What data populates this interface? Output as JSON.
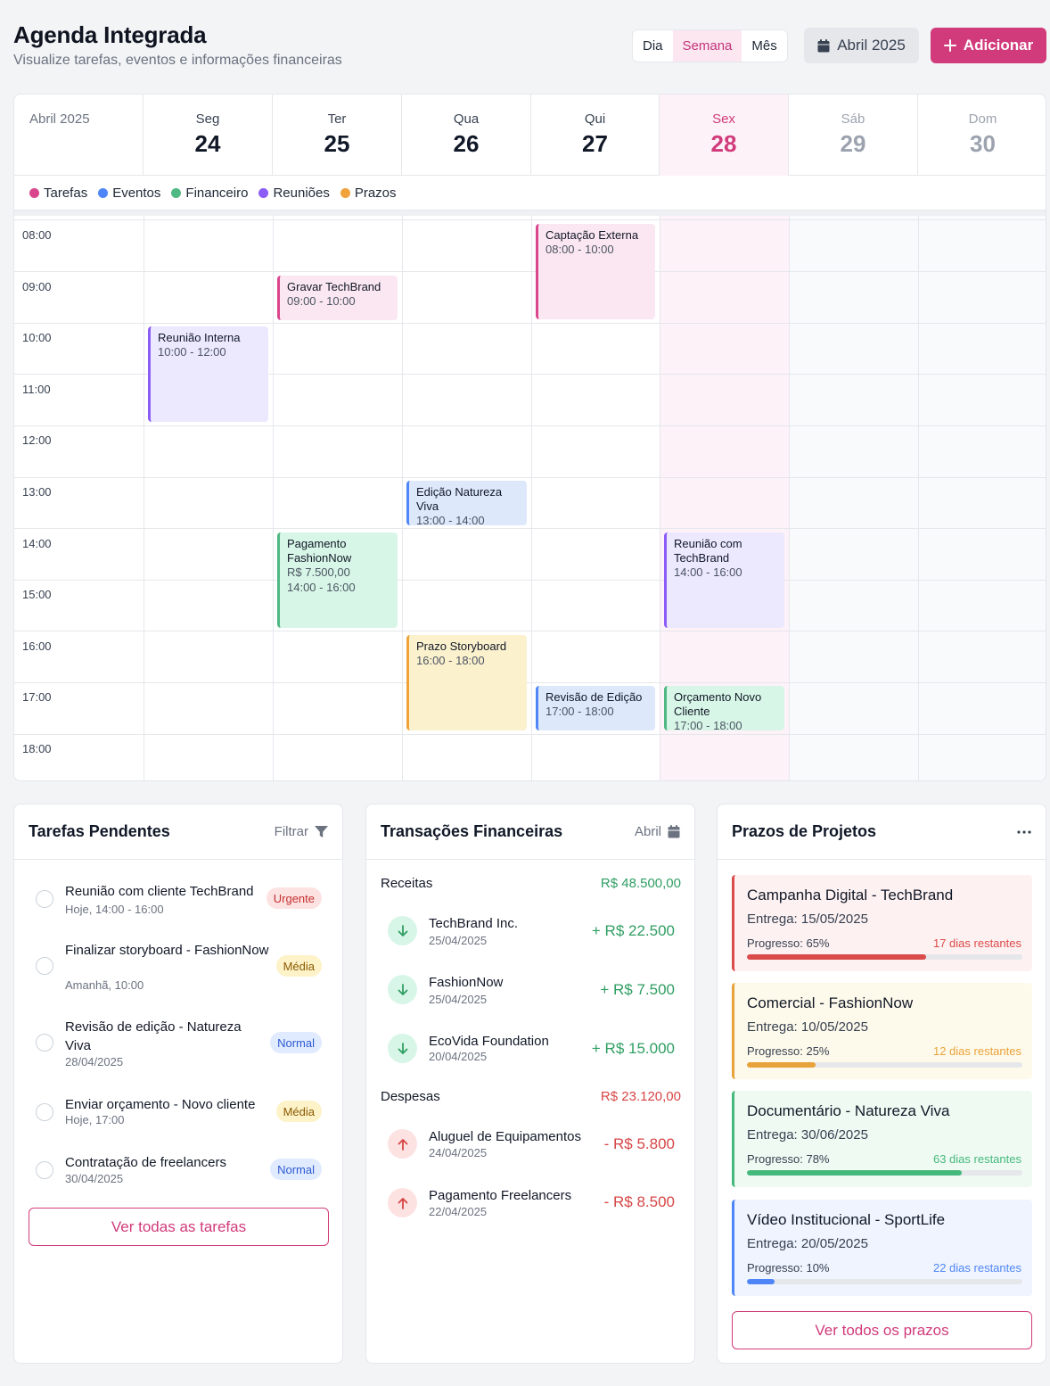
{
  "header": {
    "title": "Agenda Integrada",
    "subtitle": "Visualize tarefas, eventos e informações financeiras",
    "views": [
      "Dia",
      "Semana",
      "Mês"
    ],
    "active_view": "Semana",
    "month_label": "Abril 2025",
    "add_label": "Adicionar"
  },
  "calendar": {
    "month_label": "Abril 2025",
    "days": [
      {
        "name": "Seg",
        "num": "24"
      },
      {
        "name": "Ter",
        "num": "25"
      },
      {
        "name": "Qua",
        "num": "26"
      },
      {
        "name": "Qui",
        "num": "27"
      },
      {
        "name": "Sex",
        "num": "28"
      },
      {
        "name": "Sáb",
        "num": "29"
      },
      {
        "name": "Dom",
        "num": "30"
      }
    ],
    "today_index": 4,
    "legend": [
      {
        "label": "Tarefas",
        "color": "#d9468c"
      },
      {
        "label": "Eventos",
        "color": "#4f86f7"
      },
      {
        "label": "Financeiro",
        "color": "#4fb883"
      },
      {
        "label": "Reuniões",
        "color": "#8b5cf6"
      },
      {
        "label": "Prazos",
        "color": "#f0a23b"
      }
    ],
    "hours": [
      "08:00",
      "09:00",
      "10:00",
      "11:00",
      "12:00",
      "13:00",
      "14:00",
      "15:00",
      "16:00",
      "17:00",
      "18:00"
    ],
    "events": [
      {
        "title": "Captação Externa",
        "lines": [
          "08:00 - 10:00"
        ],
        "day": 3,
        "start": 8,
        "end": 10,
        "color": "pink"
      },
      {
        "title": "Gravar TechBrand",
        "lines": [
          "09:00 - 10:00"
        ],
        "day": 1,
        "start": 9,
        "end": 10,
        "color": "pink"
      },
      {
        "title": "Reunião Interna",
        "lines": [
          "10:00 - 12:00"
        ],
        "day": 0,
        "start": 10,
        "end": 12,
        "color": "purple"
      },
      {
        "title": "Edição Natureza Viva",
        "lines": [
          "13:00 - 14:00"
        ],
        "day": 2,
        "start": 13,
        "end": 14,
        "color": "blue"
      },
      {
        "title": "Pagamento FashionNow",
        "lines": [
          "R$ 7.500,00",
          "14:00 - 16:00"
        ],
        "day": 1,
        "start": 14,
        "end": 16,
        "color": "green"
      },
      {
        "title": "Reunião com TechBrand",
        "lines": [
          "14:00 - 16:00"
        ],
        "day": 4,
        "start": 14,
        "end": 16,
        "color": "purple"
      },
      {
        "title": "Prazo Storyboard",
        "lines": [
          "16:00 - 18:00"
        ],
        "day": 2,
        "start": 16,
        "end": 18,
        "color": "yellow"
      },
      {
        "title": "Revisão de Edição",
        "lines": [
          "17:00 - 18:00"
        ],
        "day": 3,
        "start": 17,
        "end": 18,
        "color": "blue"
      },
      {
        "title": "Orçamento Novo Cliente",
        "lines": [
          "17:00 - 18:00"
        ],
        "day": 4,
        "start": 17,
        "end": 18,
        "color": "green"
      }
    ]
  },
  "tasks": {
    "title": "Tarefas Pendentes",
    "filter_label": "Filtrar",
    "items": [
      {
        "title": "Reunião com cliente TechBrand",
        "sub": "Hoje, 14:00 - 16:00",
        "badge": "Urgente",
        "level": "urgent"
      },
      {
        "title": "Finalizar storyboard - FashionNow",
        "sub": "Amanhã, 10:00",
        "badge": "Média",
        "level": "media"
      },
      {
        "title": "Revisão de edição - Natureza Viva",
        "sub": "28/04/2025",
        "badge": "Normal",
        "level": "normal"
      },
      {
        "title": "Enviar orçamento - Novo cliente",
        "sub": "Hoje, 17:00",
        "badge": "Média",
        "level": "media"
      },
      {
        "title": "Contratação de freelancers",
        "sub": "30/04/2025",
        "badge": "Normal",
        "level": "normal"
      }
    ],
    "view_all_label": "Ver todas as tarefas"
  },
  "finance": {
    "title": "Transações Financeiras",
    "period_label": "Abril",
    "income_label": "Receitas",
    "income_total": "R$ 48.500,00",
    "income": [
      {
        "name": "TechBrand Inc.",
        "date": "25/04/2025",
        "value": "+ R$ 22.500"
      },
      {
        "name": "FashionNow",
        "date": "25/04/2025",
        "value": "+ R$ 7.500"
      },
      {
        "name": "EcoVida Foundation",
        "date": "20/04/2025",
        "value": "+ R$ 15.000"
      }
    ],
    "expense_label": "Despesas",
    "expense_total": "R$ 23.120,00",
    "expenses": [
      {
        "name": "Aluguel de Equipamentos",
        "date": "24/04/2025",
        "value": "- R$ 5.800"
      },
      {
        "name": "Pagamento Freelancers",
        "date": "22/04/2025",
        "value": "- R$ 8.500"
      }
    ]
  },
  "deadlines": {
    "title": "Prazos de Projetos",
    "items": [
      {
        "name": "Campanha Digital - TechBrand",
        "delivery": "Entrega: 15/05/2025",
        "progress_label": "Progresso: 65%",
        "progress": 65,
        "remaining": "17 dias restantes",
        "color": "#dc4b4b",
        "bg": "#fdf1f1"
      },
      {
        "name": "Comercial - FashionNow",
        "delivery": "Entrega: 10/05/2025",
        "progress_label": "Progresso: 25%",
        "progress": 25,
        "remaining": "12 dias restantes",
        "color": "#e8a23a",
        "bg": "#fefaeb"
      },
      {
        "name": "Documentário - Natureza Viva",
        "delivery": "Entrega: 30/06/2025",
        "progress_label": "Progresso: 78%",
        "progress": 78,
        "remaining": "63 dias restantes",
        "color": "#45b97c",
        "bg": "#effaf3"
      },
      {
        "name": "Vídeo Institucional - SportLife",
        "delivery": "Entrega: 20/05/2025",
        "progress_label": "Progresso: 10%",
        "progress": 10,
        "remaining": "22 dias restantes",
        "color": "#4f86f7",
        "bg": "#eff4fe"
      }
    ],
    "view_all_label": "Ver todos os prazos"
  }
}
